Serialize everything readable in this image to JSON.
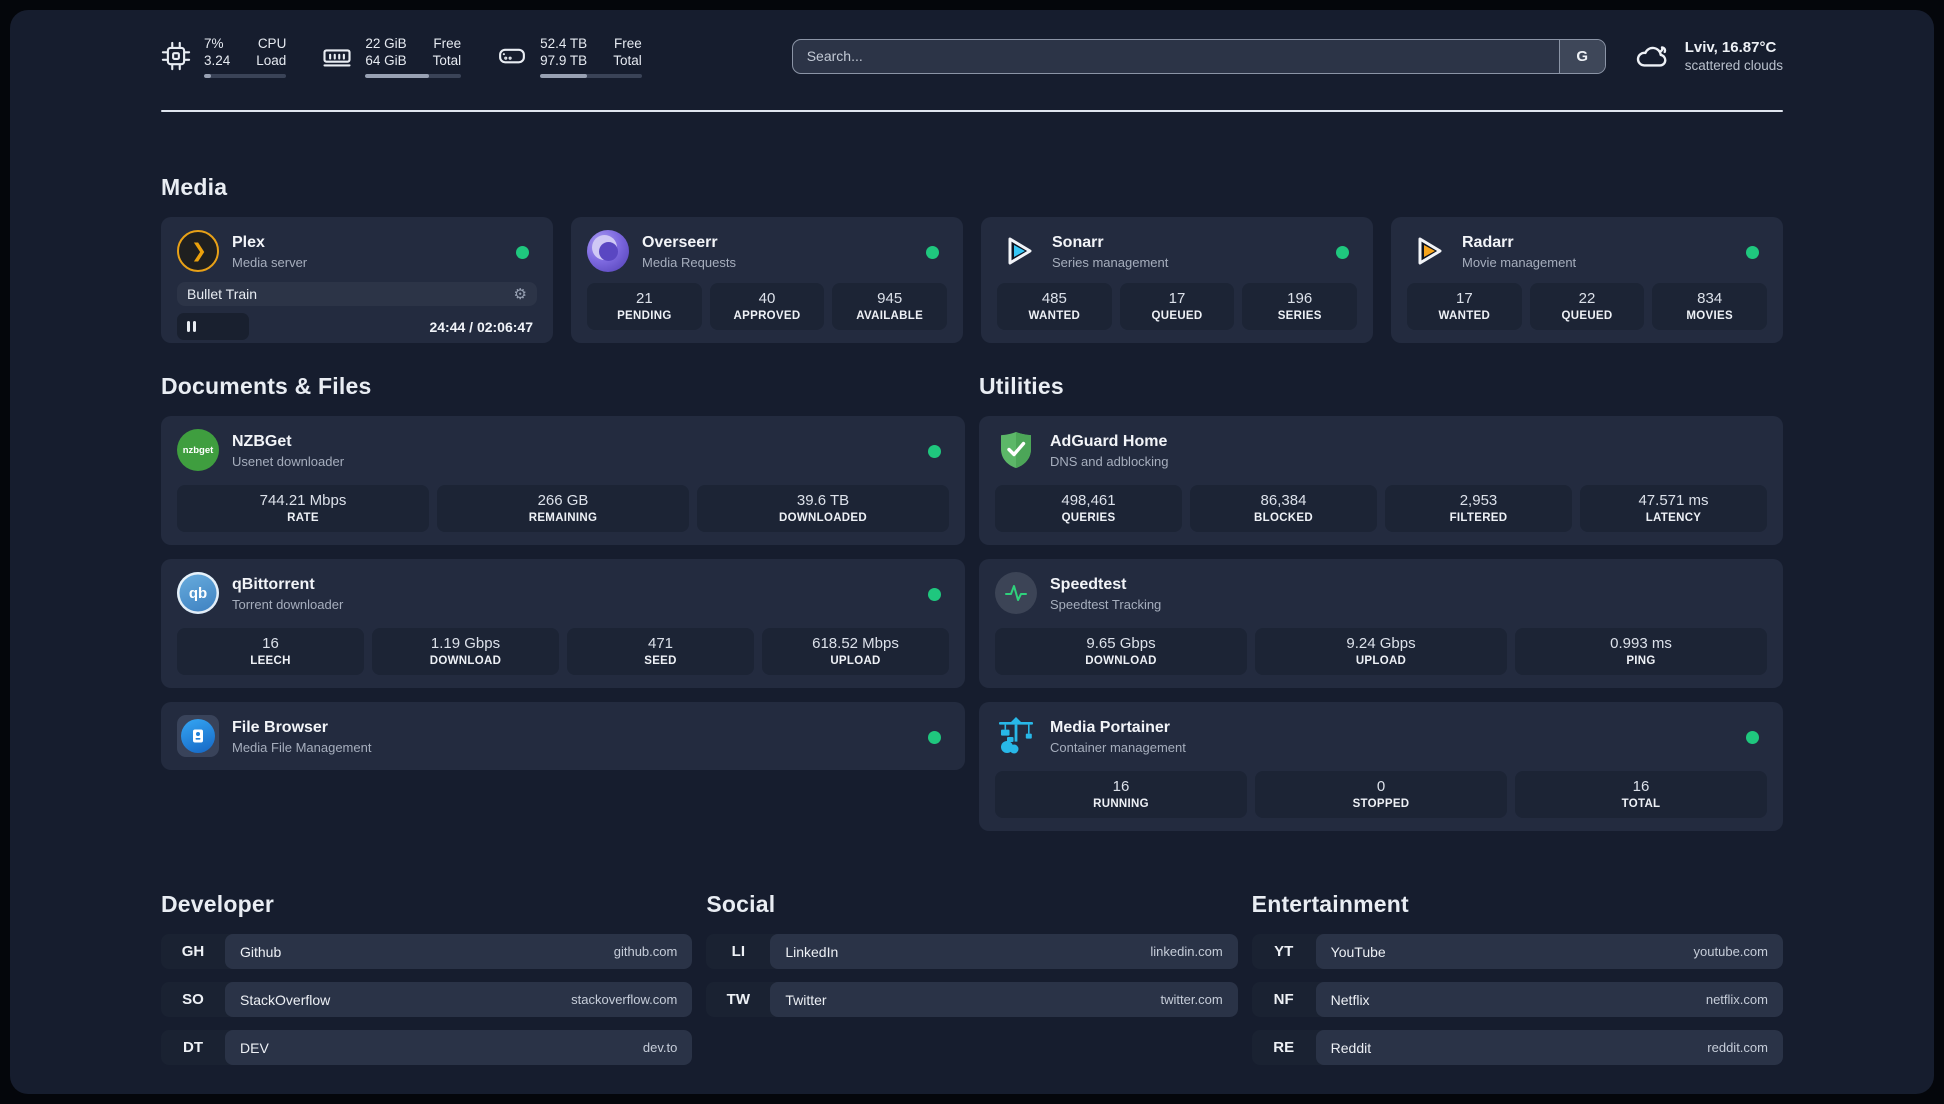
{
  "topbar": {
    "system_widgets": [
      {
        "icon": "cpu-icon",
        "value_top": "7%",
        "value_bottom": "3.24",
        "label_top": "CPU",
        "label_bottom": "Load",
        "progress_pct": 9
      },
      {
        "icon": "ram-icon",
        "value_top": "22 GiB",
        "value_bottom": "64 GiB",
        "label_top": "Free",
        "label_bottom": "Total",
        "progress_pct": 66
      },
      {
        "icon": "disk-icon",
        "value_top": "52.4 TB",
        "value_bottom": "97.9 TB",
        "label_top": "Free",
        "label_bottom": "Total",
        "progress_pct": 46
      }
    ],
    "search": {
      "placeholder": "Search...",
      "button_label": "G"
    },
    "weather": {
      "icon": "cloud-icon",
      "location_temp": "Lviv, 16.87°C",
      "condition": "scattered clouds"
    }
  },
  "colors": {
    "status_online": "#1fc77e",
    "accent_plex": "#eba10c",
    "accent_sonarr": "#36c6f4",
    "accent_radarr": "#f7a51d"
  },
  "sections": {
    "media": {
      "heading": "Media",
      "plex": {
        "title": "Plex",
        "subtitle": "Media server",
        "player": {
          "now_playing": "Bullet Train",
          "time": "24:44 / 02:06:47",
          "progress_pct": 20
        }
      },
      "overseerr": {
        "title": "Overseerr",
        "subtitle": "Media Requests",
        "stats": [
          {
            "value": "21",
            "label": "PENDING"
          },
          {
            "value": "40",
            "label": "APPROVED"
          },
          {
            "value": "945",
            "label": "AVAILABLE"
          }
        ]
      },
      "sonarr": {
        "title": "Sonarr",
        "subtitle": "Series management",
        "stats": [
          {
            "value": "485",
            "label": "WANTED"
          },
          {
            "value": "17",
            "label": "QUEUED"
          },
          {
            "value": "196",
            "label": "SERIES"
          }
        ]
      },
      "radarr": {
        "title": "Radarr",
        "subtitle": "Movie management",
        "stats": [
          {
            "value": "17",
            "label": "WANTED"
          },
          {
            "value": "22",
            "label": "QUEUED"
          },
          {
            "value": "834",
            "label": "MOVIES"
          }
        ]
      }
    },
    "documents": {
      "heading": "Documents & Files",
      "nzbget": {
        "title": "NZBGet",
        "subtitle": "Usenet downloader",
        "icon_text": "nzbget",
        "stats": [
          {
            "value": "744.21 Mbps",
            "label": "RATE"
          },
          {
            "value": "266 GB",
            "label": "REMAINING"
          },
          {
            "value": "39.6 TB",
            "label": "DOWNLOADED"
          }
        ]
      },
      "qbittorrent": {
        "title": "qBittorrent",
        "subtitle": "Torrent downloader",
        "icon_text": "qb",
        "stats": [
          {
            "value": "16",
            "label": "LEECH"
          },
          {
            "value": "1.19 Gbps",
            "label": "DOWNLOAD"
          },
          {
            "value": "471",
            "label": "SEED"
          },
          {
            "value": "618.52 Mbps",
            "label": "UPLOAD"
          }
        ]
      },
      "filebrowser": {
        "title": "File Browser",
        "subtitle": "Media File Management"
      }
    },
    "utilities": {
      "heading": "Utilities",
      "adguard": {
        "title": "AdGuard Home",
        "subtitle": "DNS and adblocking",
        "stats": [
          {
            "value": "498,461",
            "label": "QUERIES"
          },
          {
            "value": "86,384",
            "label": "BLOCKED"
          },
          {
            "value": "2,953",
            "label": "FILTERED"
          },
          {
            "value": "47.571 ms",
            "label": "LATENCY"
          }
        ]
      },
      "speedtest": {
        "title": "Speedtest",
        "subtitle": "Speedtest Tracking",
        "stats": [
          {
            "value": "9.65 Gbps",
            "label": "DOWNLOAD"
          },
          {
            "value": "9.24 Gbps",
            "label": "UPLOAD"
          },
          {
            "value": "0.993 ms",
            "label": "PING"
          }
        ]
      },
      "portainer": {
        "title": "Media Portainer",
        "subtitle": "Container management",
        "stats": [
          {
            "value": "16",
            "label": "RUNNING"
          },
          {
            "value": "0",
            "label": "STOPPED"
          },
          {
            "value": "16",
            "label": "TOTAL"
          }
        ]
      }
    },
    "developer": {
      "heading": "Developer",
      "links": [
        {
          "abbr": "GH",
          "name": "Github",
          "url": "github.com"
        },
        {
          "abbr": "SO",
          "name": "StackOverflow",
          "url": "stackoverflow.com"
        },
        {
          "abbr": "DT",
          "name": "DEV",
          "url": "dev.to"
        }
      ]
    },
    "social": {
      "heading": "Social",
      "links": [
        {
          "abbr": "LI",
          "name": "LinkedIn",
          "url": "linkedin.com"
        },
        {
          "abbr": "TW",
          "name": "Twitter",
          "url": "twitter.com"
        }
      ]
    },
    "entertainment": {
      "heading": "Entertainment",
      "links": [
        {
          "abbr": "YT",
          "name": "YouTube",
          "url": "youtube.com"
        },
        {
          "abbr": "NF",
          "name": "Netflix",
          "url": "netflix.com"
        },
        {
          "abbr": "RE",
          "name": "Reddit",
          "url": "reddit.com"
        }
      ]
    }
  }
}
